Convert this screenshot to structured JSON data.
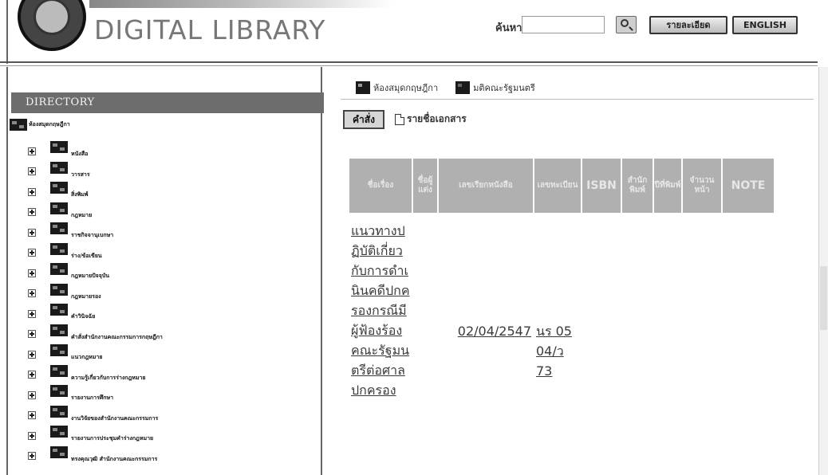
{
  "header": {
    "title": "DIGITAL LIBRARY",
    "search_label": "ค้นหา",
    "search_value": "",
    "detail_button": "รายละเอียด",
    "english_button": "ENGLISH"
  },
  "directory": {
    "heading": "DIRECTORY",
    "root_label": "ห้องสมุดกฤษฎีกา",
    "items": [
      "หนังสือ",
      "วารสาร",
      "สิ่งพิมพ์",
      "กฎหมาย",
      "ราชกิจจานุเบกษา",
      "ร่าง/ข้อเขียน",
      "กฎหมายปัจจุบัน",
      "กฎหมายรอง",
      "คำวินิจฉัย",
      "คำสั่งสำนักงานคณะกรรมการกฤษฎีกา",
      "แนวกฎหมาย",
      "ความรู้เกี่ยวกับการร่างกฎหมาย",
      "รายงานการศึกษา",
      "งานวิจัยของสำนักงานคณะกรรมการ",
      "รายงานการประชุมคำร่างกฎหมาย",
      "ทรงคุณวุฒิ สำนักงานคณะกรรมการ"
    ]
  },
  "breadcrumb": {
    "item1": "ห้องสมุดกฤษฎีกา",
    "item2": "มติคณะรัฐมนตรี"
  },
  "toolbar": {
    "command_button": "คำสั่ง",
    "doc_list_label": "รายชื่อเอกสาร"
  },
  "results": {
    "columns": [
      "ชื่อเรื่อง",
      "ชื่อผู้แต่ง",
      "เลขเรียกหนังสือ",
      "เลขทะเบียน",
      "ISBN",
      "สำนักพิมพ์",
      "ปีที่พิมพ์",
      "จำนวนหน้า",
      "NOTE"
    ],
    "rows": [
      {
        "title": "แนวทางปฏิบัติเกี่ยวกับการดำเนินคดีปกครองกรณีมีผู้ฟ้องร้องคณะรัฐมนตรีต่อศาลปกครอง",
        "date": "02/04/2547",
        "book_number": "นร 0504/ว 73"
      }
    ]
  }
}
